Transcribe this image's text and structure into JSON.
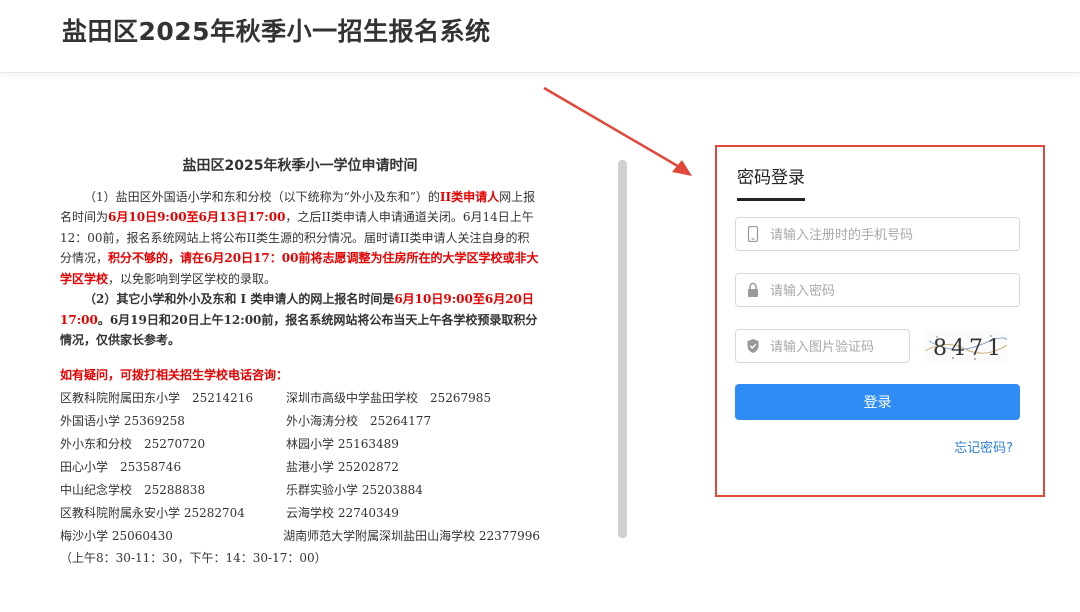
{
  "header": {
    "title": "盐田区2025年秋季小一招生报名系统"
  },
  "notice": {
    "title": "盐田区2025年秋季小一学位申请时间",
    "para1": {
      "a": "（1）盐田区外国语小学和东和分校（以下统称为“外小及东和”）的",
      "b": "II类申请人",
      "c": "网上报名时间为",
      "d": "6月10日9:00至6月13日17:00",
      "e": "，之后II类申请人申请通道关闭。6月14日上午12：00前，报名系统网站上将公布II类生源的积分情况。届时请II类申请人关注自身的积分情况，",
      "f": "积分不够的，请在6月20日17：00前将志愿调整为住房所在的大学区学校或非大学区学校",
      "g": "，以免影响到学区学校的录取。"
    },
    "para2": {
      "a": "（2）其它小学和外小及东和 I 类申请人的网上报名时间是",
      "b": "6月10日9:00至6月20日17:00",
      "c": "。6月19日和20日上午12:00前，报名系统网站将公布当天上午各学校预录取积分情况，仅供家长参考。"
    },
    "question_heading": "如有疑问，可拨打相关招生学校电话咨询：",
    "contacts": [
      [
        "区教科院附属田东小学　25214216",
        "深圳市高级中学盐田学校　25267985"
      ],
      [
        "外国语小学 25369258",
        "外小海涛分校　25264177"
      ],
      [
        "外小东和分校　25270720",
        "林园小学 25163489"
      ],
      [
        "田心小学　25358746",
        "盐港小学 25202872"
      ],
      [
        "中山纪念学校　25288838",
        "乐群实验小学 25203884"
      ],
      [
        "区教科院附属永安小学 25282704",
        "云海学校 22740349"
      ],
      [
        "梅沙小学 25060430",
        "湖南师范大学附属深圳盐田山海学校 22377996"
      ]
    ],
    "hours": "（上午8：30-11：30，下午：14：30-17：00）"
  },
  "login": {
    "tab_label": "密码登录",
    "phone_placeholder": "请输入注册时的手机号码",
    "password_placeholder": "请输入密码",
    "captcha_placeholder": "请输入图片验证码",
    "captcha_text": "8471",
    "submit_label": "登录",
    "forgot_label": "忘记密码?"
  },
  "colors": {
    "accent_button": "#2f8cf4",
    "highlight_border": "#e0483a",
    "notice_red": "#e60000",
    "link": "#2f7fd8"
  },
  "icons": [
    "phone-icon",
    "lock-icon",
    "shield-icon",
    "arrow-annotation"
  ]
}
